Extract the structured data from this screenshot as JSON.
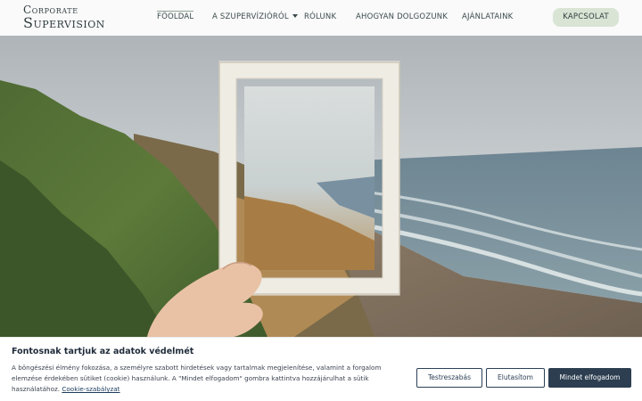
{
  "logo": {
    "line1": "Corporate",
    "line2": "Supervision"
  },
  "nav": {
    "items": [
      {
        "label": "FŐOLDAL"
      },
      {
        "label": "A SZUPERVÍZIÓRÓL"
      },
      {
        "label": "RÓLUNK"
      },
      {
        "label": "AHOGYAN DOLGOZUNK"
      },
      {
        "label": "AJÁNLATAINK"
      }
    ],
    "contact": "KAPCSOLAT"
  },
  "cookie": {
    "title": "Fontosnak tartjuk az adatok védelmét",
    "text": "A böngészési élmény fokozása, a személyre szabott hirdetések vagy tartalmak megjelenítése, valamint a forgalom elemzése érdekében sütiket (cookie) használunk. A \"Mindet elfogadom\" gombra kattintva hozzájárulhat a sütik használatához.",
    "link": "Cookie-szabályzat",
    "buttons": {
      "customize": "Testreszabás",
      "reject": "Elutasítom",
      "accept": "Mindet elfogadom"
    }
  }
}
